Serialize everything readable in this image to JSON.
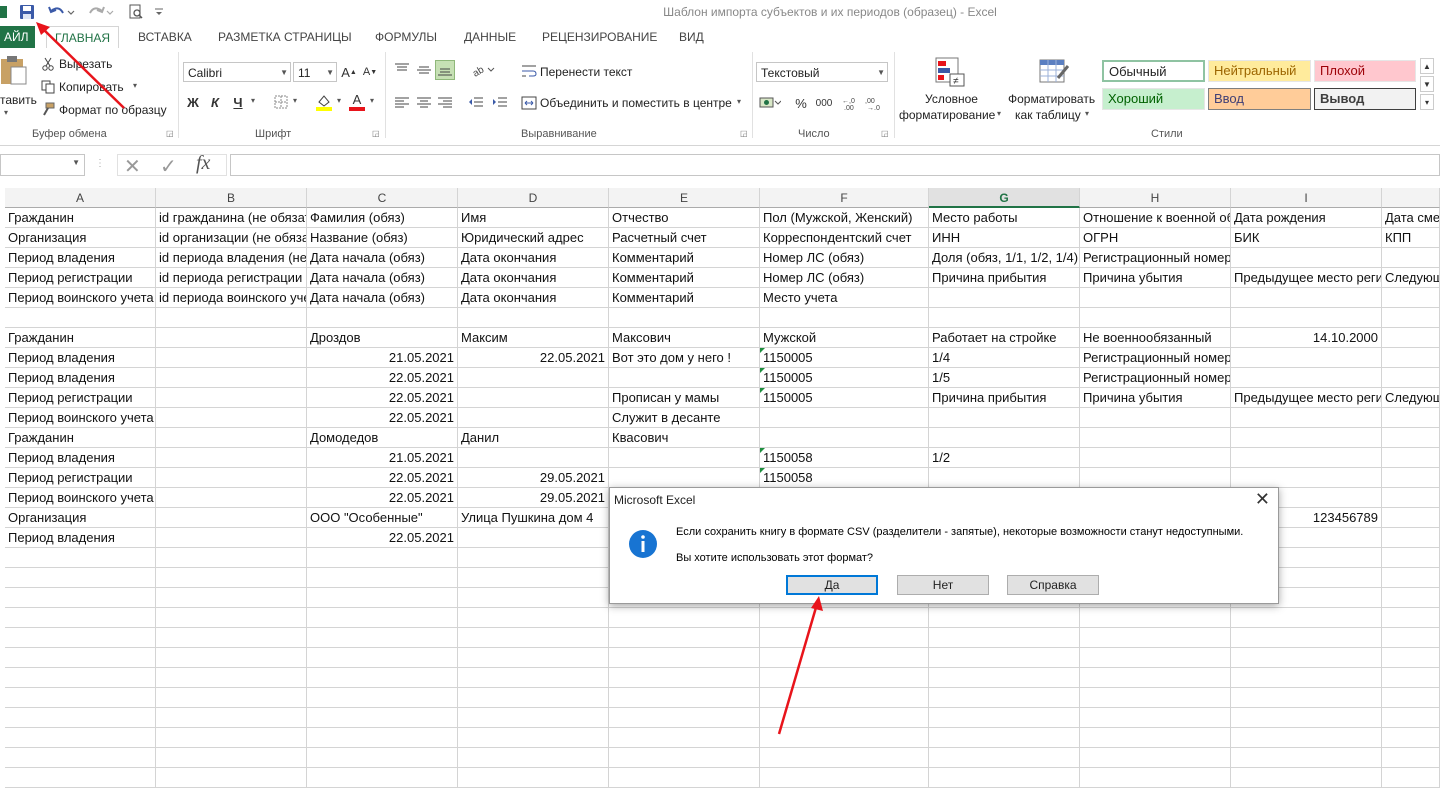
{
  "window": {
    "title": "Шаблон импорта субъектов и их периодов (образец) - Excel"
  },
  "tabs": [
    "АЙЛ",
    "ГЛАВНАЯ",
    "ВСТАВКА",
    "РАЗМЕТКА СТРАНИЦЫ",
    "ФОРМУЛЫ",
    "ДАННЫЕ",
    "РЕЦЕНЗИРОВАНИЕ",
    "ВИД"
  ],
  "ribbon": {
    "clipboard": {
      "paste": "тавить",
      "cut": "Вырезать",
      "copy": "Копировать",
      "format_painter": "Формат по образцу",
      "label": "Буфер обмена"
    },
    "font": {
      "name": "Calibri",
      "size": "11",
      "bold": "Ж",
      "italic": "К",
      "underline": "Ч",
      "label": "Шрифт"
    },
    "alignment": {
      "wrap": "Перенести текст",
      "merge": "Объединить и поместить в центре",
      "label": "Выравнивание"
    },
    "number": {
      "format": "Текстовый",
      "label": "Число",
      "percent": "%",
      "thousands": "000"
    },
    "styles": {
      "conditional": [
        "Условное",
        "форматирование"
      ],
      "table": [
        "Форматировать",
        "как таблицу"
      ],
      "cells": [
        "Обычный",
        "Нейтральный",
        "Плохой",
        "Хороший",
        "Ввод",
        "Вывод"
      ],
      "label": "Стили"
    }
  },
  "formula_bar": {
    "fx": "fx",
    "value": ""
  },
  "columns": [
    "A",
    "B",
    "C",
    "D",
    "E",
    "F",
    "G",
    "H",
    "I",
    ""
  ],
  "rows": [
    [
      "Гражданин",
      "id гражданина (не обязательный)",
      "Фамилия (обяз)",
      "Имя",
      "Отчество",
      "Пол (Мужской, Женский)",
      "Место работы",
      "Отношение к военной обязанности",
      "Дата рождения",
      "Дата смерти"
    ],
    [
      "Организация",
      "id организации (не обязательный)",
      "Название (обяз)",
      "Юридический адрес",
      "Расчетный счет",
      "Корреспондентский счет",
      "ИНН",
      "ОГРН",
      "БИК",
      "КПП"
    ],
    [
      "Период владения",
      "id периода владения (не обязательный)",
      "Дата начала (обяз)",
      "Дата окончания",
      "Комментарий",
      "Номер ЛС (обяз)",
      "Доля (обяз, 1/1, 1/2, 1/4)",
      "Регистрационный номер",
      "",
      ""
    ],
    [
      "Период регистрации",
      "id периода регистрации (не обязательный)",
      "Дата начала (обяз)",
      "Дата окончания",
      "Комментарий",
      "Номер ЛС (обяз)",
      "Причина прибытия",
      "Причина убытия",
      "Предыдущее место регистрации",
      "Следующее место"
    ],
    [
      "Период воинского учета",
      "id периода воинского учета (не обязательный)",
      "Дата начала (обяз)",
      "Дата окончания",
      "Комментарий",
      "Место учета",
      "",
      "",
      "",
      ""
    ],
    [
      "",
      "",
      "",
      "",
      "",
      "",
      "",
      "",
      "",
      ""
    ],
    [
      "Гражданин",
      "",
      "Дроздов",
      "Максим",
      "Максович",
      "Мужской",
      "Работает на стройке",
      "Не военнообязанный",
      "14.10.2000",
      ""
    ],
    [
      "Период владения",
      "",
      "21.05.2021",
      "22.05.2021",
      "Вот это дом у него !",
      "1150005",
      "1/4",
      "Регистрационный номер",
      "",
      ""
    ],
    [
      "Период владения",
      "",
      "22.05.2021",
      "",
      "",
      "1150005",
      "1/5",
      "Регистрационный номер",
      "",
      ""
    ],
    [
      "Период регистрации",
      "",
      "22.05.2021",
      "",
      "Прописан у мамы",
      "1150005",
      "Причина прибытия",
      "Причина убытия",
      "Предыдущее место регистрации",
      "Следующее место"
    ],
    [
      "Период воинского учета",
      "",
      "22.05.2021",
      "",
      "Служит в десанте",
      "",
      "",
      "",
      "",
      ""
    ],
    [
      "Гражданин",
      "",
      "Домодедов",
      "Данил",
      "Квасович",
      "",
      "",
      "",
      "",
      ""
    ],
    [
      "Период владения",
      "",
      "21.05.2021",
      "",
      "",
      "1150058",
      "1/2",
      "",
      "",
      ""
    ],
    [
      "Период регистрации",
      "",
      "22.05.2021",
      "29.05.2021",
      "",
      "1150058",
      "",
      "",
      "",
      ""
    ],
    [
      "Период воинского учета",
      "",
      "22.05.2021",
      "29.05.2021",
      "",
      "",
      "",
      "",
      "",
      ""
    ],
    [
      "Организация",
      "",
      "ООО \"Особенные\"",
      "Улица Пушкина дом 4",
      "",
      "",
      "",
      "",
      "123456789",
      ""
    ],
    [
      "Период владения",
      "",
      "22.05.2021",
      "",
      "",
      "",
      "",
      "",
      "",
      ""
    ]
  ],
  "dialog": {
    "title": "Microsoft Excel",
    "icon": "info-icon",
    "message": "Если сохранить книгу в формате CSV (разделители - запятые), некоторые возможности станут недоступными.",
    "question": "Вы хотите использовать этот формат?",
    "buttons": [
      "Да",
      "Нет",
      "Справка"
    ]
  },
  "colors": {
    "excel_green": "#217346",
    "annotation_arrow": "#e8141b",
    "dialog_default": "#0078d7"
  }
}
